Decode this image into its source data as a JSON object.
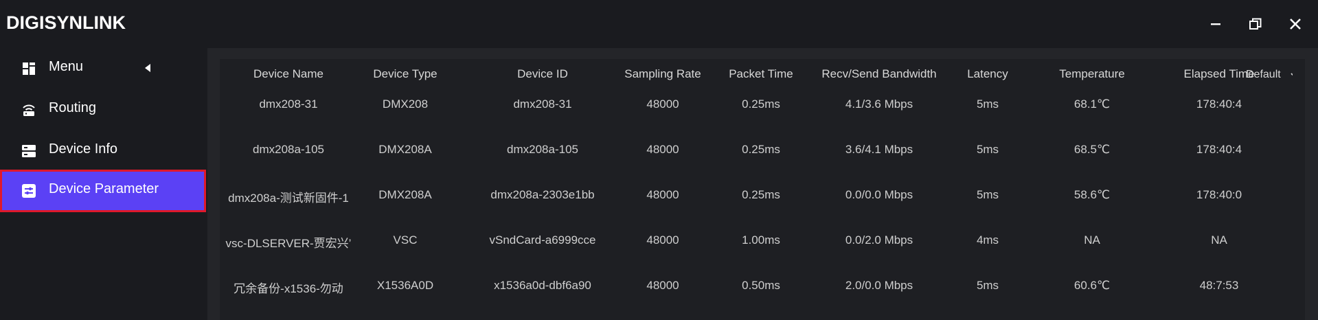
{
  "app": {
    "title": "DIGISYNLINK",
    "window_controls": [
      "minimize-icon",
      "restore-icon",
      "close-icon"
    ]
  },
  "sidebar": {
    "items": [
      {
        "label": "Menu",
        "icon": "grid-icon"
      },
      {
        "label": "Routing",
        "icon": "router-icon"
      },
      {
        "label": "Device Info",
        "icon": "server-icon"
      },
      {
        "label": "Device Parameter",
        "icon": "sliders-icon",
        "active": true
      }
    ]
  },
  "table": {
    "columns": [
      "Device Name",
      "Device Type",
      "Device ID",
      "Sampling Rate",
      "Packet Time",
      "Recv/Send Bandwidth",
      "Latency",
      "Temperature",
      "Elapsed Time"
    ],
    "column_select": "Default",
    "rows": [
      [
        "dmx208-31",
        "DMX208",
        "dmx208-31",
        "48000",
        "0.25ms",
        "4.1/3.6 Mbps",
        "5ms",
        "68.1℃",
        "178:40:4"
      ],
      [
        "dmx208a-105",
        "DMX208A",
        "dmx208a-105",
        "48000",
        "0.25ms",
        "3.6/4.1 Mbps",
        "5ms",
        "68.5℃",
        "178:40:4"
      ],
      [
        "dmx208a-测试新固件-1",
        "DMX208A",
        "dmx208a-2303e1bb",
        "48000",
        "0.25ms",
        "0.0/0.0 Mbps",
        "5ms",
        "58.6℃",
        "178:40:0"
      ],
      [
        "vsc-DLSERVER-贾宏兴’",
        "VSC",
        "vSndCard-a6999cce",
        "48000",
        "1.00ms",
        "0.0/2.0 Mbps",
        "4ms",
        "NA",
        "NA"
      ],
      [
        "冗余备份-x1536-勿动",
        "X1536A0D",
        "x1536a0d-dbf6a90",
        "48000",
        "0.50ms",
        "2.0/0.0 Mbps",
        "5ms",
        "60.6℃",
        "48:7:53"
      ]
    ]
  },
  "colors": {
    "accent": "#5b41f5",
    "highlight_border": "#e0192b",
    "background": "#1a1b1f",
    "panel": "#242529"
  }
}
